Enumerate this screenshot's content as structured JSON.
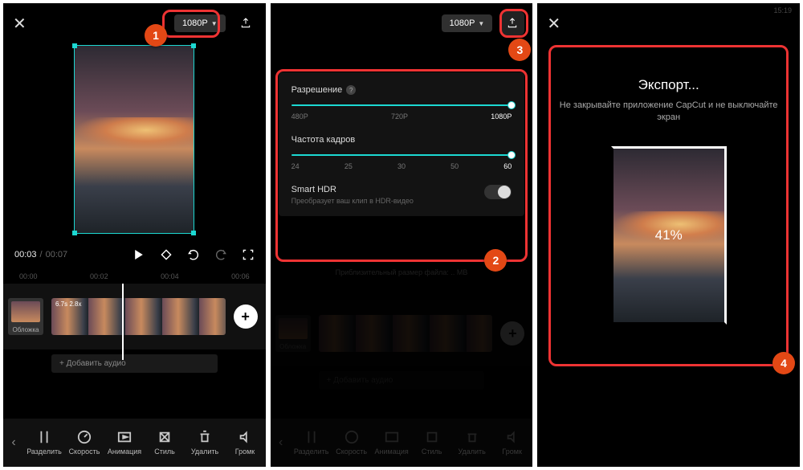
{
  "common": {
    "resolution": "1080P",
    "close": "✕"
  },
  "s1": {
    "time_current": "00:03",
    "time_sep": "/",
    "time_total": "00:07",
    "ruler": [
      "00:00",
      "00:02",
      "00:04",
      "00:06"
    ],
    "clip_info": "6.7s   2.8x",
    "cover": "Обложка",
    "add_audio": "+ Добавить аудио",
    "tools": [
      "Разделить",
      "Скорость",
      "Анимация",
      "Стиль",
      "Удалить",
      "Громк"
    ]
  },
  "s2": {
    "resolution_label": "Разрешение",
    "res_ticks": [
      "480P",
      "720P",
      "1080P"
    ],
    "fps_label": "Частота кадров",
    "fps_ticks": [
      "24",
      "25",
      "30",
      "50",
      "60"
    ],
    "hdr_title": "Smart HDR",
    "hdr_sub": "Преобразует ваш клип в HDR-видео",
    "filesize": "Приблизительный размер файла: .. MB"
  },
  "s3": {
    "title": "Экспорт...",
    "sub": "Не закрывайте приложение CapCut и не выключайте экран",
    "percent": "41%",
    "clock": "15:19"
  },
  "badges": {
    "b1": "1",
    "b2": "2",
    "b3": "3",
    "b4": "4"
  }
}
